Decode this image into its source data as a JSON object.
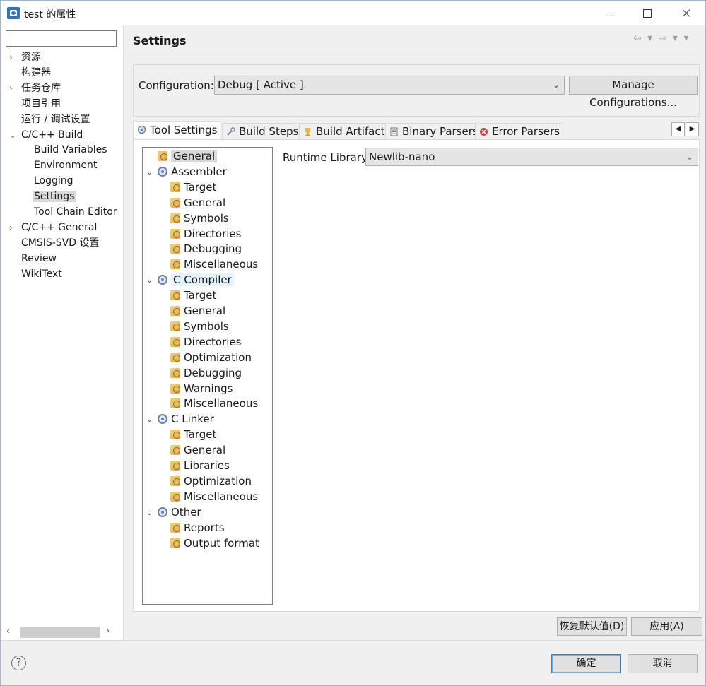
{
  "window": {
    "title": "test 的属性"
  },
  "nav": {
    "filter_value": "",
    "items": [
      {
        "label": "资源",
        "expandable": true
      },
      {
        "label": "构建器"
      },
      {
        "label": "任务仓库",
        "expandable": true
      },
      {
        "label": "项目引用"
      },
      {
        "label": "运行 / 调试设置"
      },
      {
        "label": "C/C++ Build",
        "expanded": true
      },
      {
        "label": "Build Variables"
      },
      {
        "label": "Environment"
      },
      {
        "label": "Logging"
      },
      {
        "label": "Settings",
        "selected": true
      },
      {
        "label": "Tool Chain Editor"
      },
      {
        "label": "C/C++ General",
        "expandable": true
      },
      {
        "label": "CMSIS-SVD 设置"
      },
      {
        "label": "Review"
      },
      {
        "label": "WikiText"
      }
    ]
  },
  "header": {
    "title": "Settings",
    "nav_arrows": "⇦ ▾ ⇨ ▾ ▾"
  },
  "config": {
    "label": "Configuration:",
    "value": "Debug  [ Active ]",
    "manage_label": "Manage Configurations..."
  },
  "tabs": [
    {
      "label": "Tool Settings",
      "icon": "gear-icon",
      "active": true
    },
    {
      "label": "Build Steps",
      "icon": "wrench-icon"
    },
    {
      "label": "Build Artifact",
      "icon": "trophy-icon"
    },
    {
      "label": "Binary Parsers",
      "icon": "document-icon"
    },
    {
      "label": "Error Parsers",
      "icon": "error-icon"
    }
  ],
  "tree": [
    {
      "label": "General",
      "level": 0,
      "icon": "folder-icon",
      "selected": true
    },
    {
      "label": "Assembler",
      "level": 0,
      "icon": "gear-icon",
      "expanded": true
    },
    {
      "label": "Target",
      "level": 1,
      "icon": "folder-icon"
    },
    {
      "label": "General",
      "level": 1,
      "icon": "folder-icon"
    },
    {
      "label": "Symbols",
      "level": 1,
      "icon": "folder-icon"
    },
    {
      "label": "Directories",
      "level": 1,
      "icon": "folder-icon"
    },
    {
      "label": "Debugging",
      "level": 1,
      "icon": "folder-icon"
    },
    {
      "label": "Miscellaneous",
      "level": 1,
      "icon": "folder-icon"
    },
    {
      "label": "C Compiler",
      "level": 0,
      "icon": "gear-icon",
      "expanded": true,
      "highlighted": true
    },
    {
      "label": "Target",
      "level": 1,
      "icon": "folder-icon"
    },
    {
      "label": "General",
      "level": 1,
      "icon": "folder-icon"
    },
    {
      "label": "Symbols",
      "level": 1,
      "icon": "folder-icon"
    },
    {
      "label": "Directories",
      "level": 1,
      "icon": "folder-icon"
    },
    {
      "label": "Optimization",
      "level": 1,
      "icon": "folder-icon"
    },
    {
      "label": "Debugging",
      "level": 1,
      "icon": "folder-icon"
    },
    {
      "label": "Warnings",
      "level": 1,
      "icon": "folder-icon"
    },
    {
      "label": "Miscellaneous",
      "level": 1,
      "icon": "folder-icon"
    },
    {
      "label": "C Linker",
      "level": 0,
      "icon": "gear-icon",
      "expanded": true
    },
    {
      "label": "Target",
      "level": 1,
      "icon": "folder-icon"
    },
    {
      "label": "General",
      "level": 1,
      "icon": "folder-icon"
    },
    {
      "label": "Libraries",
      "level": 1,
      "icon": "folder-icon"
    },
    {
      "label": "Optimization",
      "level": 1,
      "icon": "folder-icon"
    },
    {
      "label": "Miscellaneous",
      "level": 1,
      "icon": "folder-icon"
    },
    {
      "label": "Other",
      "level": 0,
      "icon": "gear-icon",
      "expanded": true
    },
    {
      "label": "Reports",
      "level": 1,
      "icon": "folder-icon"
    },
    {
      "label": "Output format",
      "level": 1,
      "icon": "folder-icon"
    }
  ],
  "runtime": {
    "label": "Runtime Library",
    "value": "Newlib-nano"
  },
  "buttons": {
    "restore_defaults": "恢复默认值(D)",
    "apply": "应用(A)",
    "ok": "确定",
    "cancel": "取消"
  },
  "colors": {
    "accent": "#2f74c6",
    "selection": "#d9d9d9",
    "highlight": "#e5f3fb"
  }
}
